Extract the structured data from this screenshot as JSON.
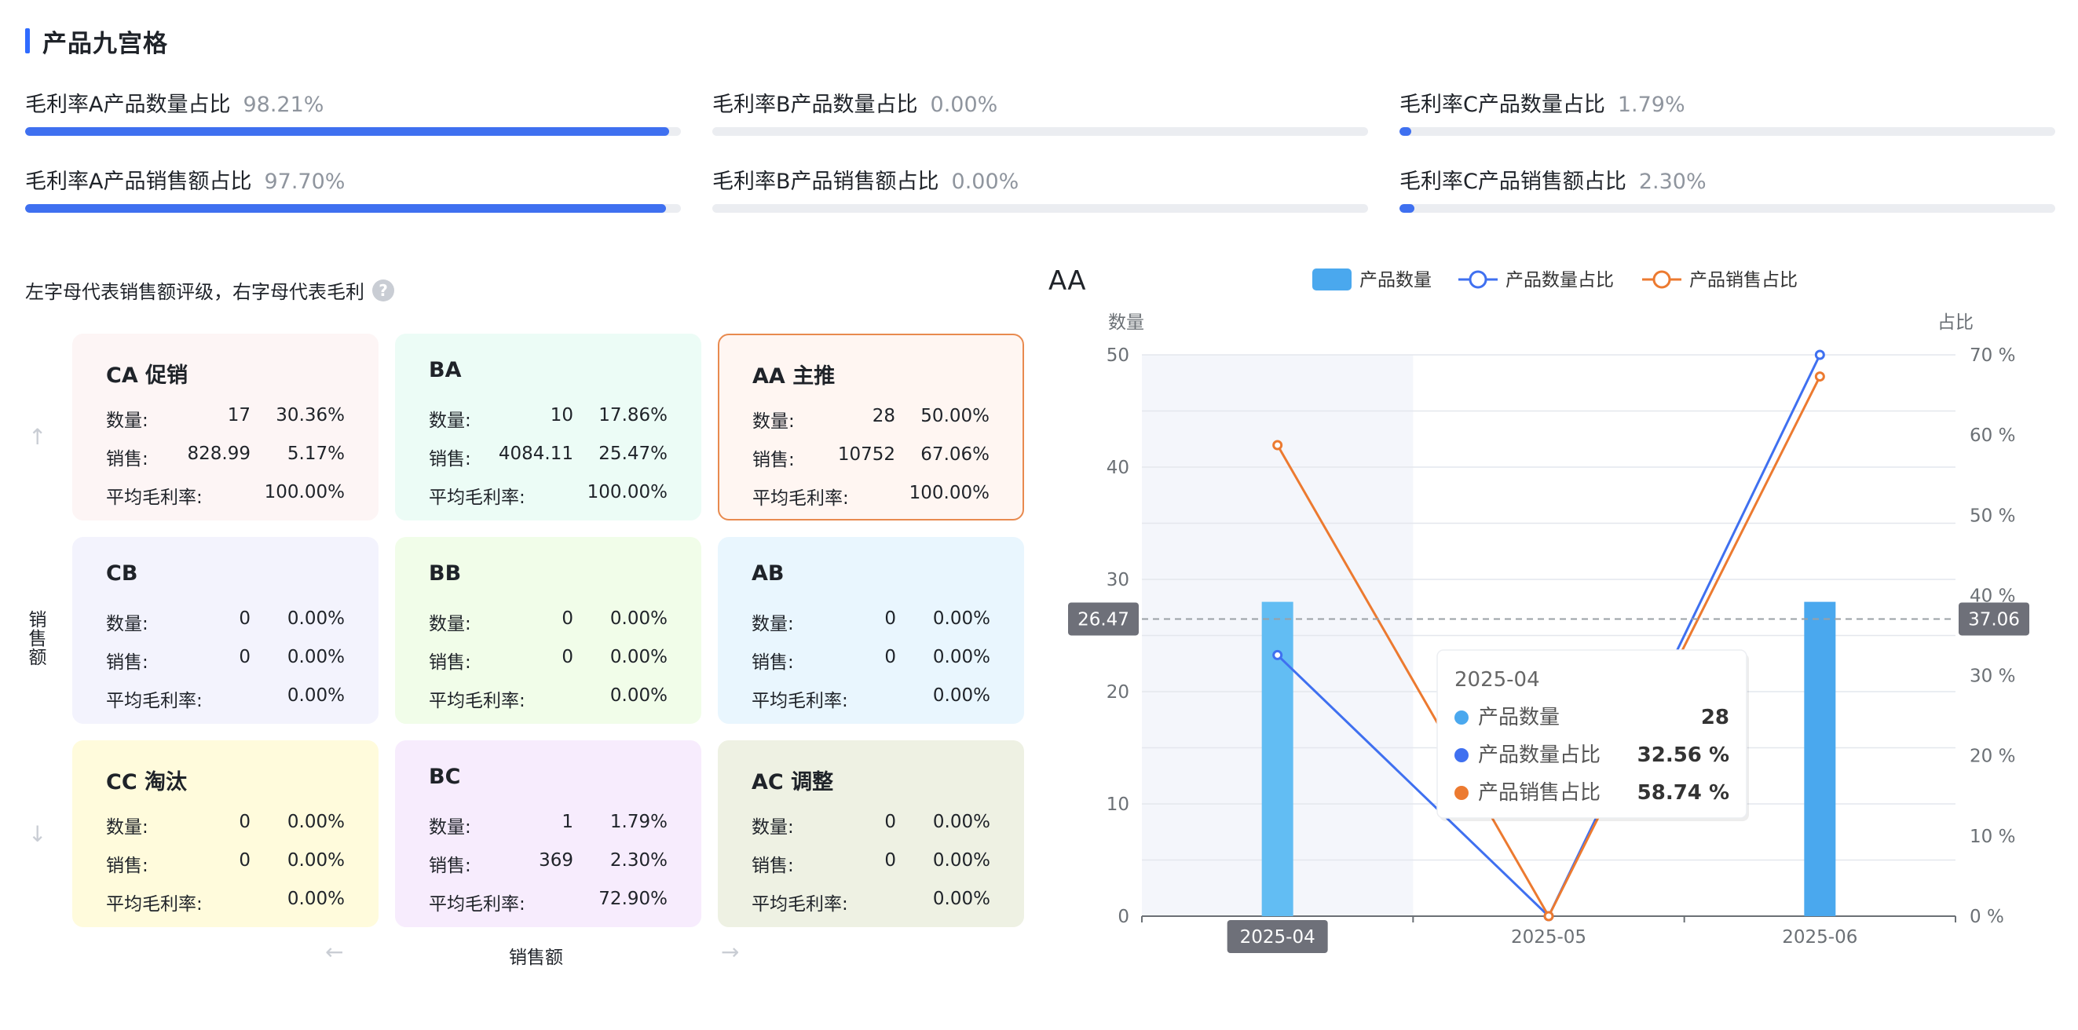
{
  "title": "产品九宫格",
  "ratios": [
    {
      "label": "毛利率A产品数量占比",
      "value": "98.21%",
      "fill": 0.9821
    },
    {
      "label": "毛利率B产品数量占比",
      "value": "0.00%",
      "fill": 0.0
    },
    {
      "label": "毛利率C产品数量占比",
      "value": "1.79%",
      "fill": 0.0179
    },
    {
      "label": "毛利率A产品销售额占比",
      "value": "97.70%",
      "fill": 0.977
    },
    {
      "label": "毛利率B产品销售额占比",
      "value": "0.00%",
      "fill": 0.0
    },
    {
      "label": "毛利率C产品销售额占比",
      "value": "2.30%",
      "fill": 0.023
    }
  ],
  "grid": {
    "note": "左字母代表销售额评级，右字母代表毛利",
    "help_glyph": "?",
    "y_label": "销售额",
    "x_label": "销售额",
    "up_arrow": "↑",
    "down_arrow": "↓",
    "left_arrow": "←",
    "right_arrow": "→",
    "qty_label": "数量:",
    "sales_label": "销售:",
    "margin_label": "平均毛利率:",
    "cells": [
      {
        "title": "CA 促销",
        "qty": "17",
        "qty_pct": "30.36%",
        "sales": "828.99",
        "sales_pct": "5.17%",
        "margin": "100.00%",
        "bg": "#fdf5f5",
        "border": "#fdf5f5"
      },
      {
        "title": "BA",
        "qty": "10",
        "qty_pct": "17.86%",
        "sales": "4084.11",
        "sales_pct": "25.47%",
        "margin": "100.00%",
        "bg": "#ecfcf6",
        "border": "#ecfcf6"
      },
      {
        "title": "AA 主推",
        "qty": "28",
        "qty_pct": "50.00%",
        "sales": "10752",
        "sales_pct": "67.06%",
        "margin": "100.00%",
        "bg": "#fff6f2",
        "border": "#e88a4f"
      },
      {
        "title": "CB",
        "qty": "0",
        "qty_pct": "0.00%",
        "sales": "0",
        "sales_pct": "0.00%",
        "margin": "0.00%",
        "bg": "#f3f3fd",
        "border": "#f3f3fd"
      },
      {
        "title": "BB",
        "qty": "0",
        "qty_pct": "0.00%",
        "sales": "0",
        "sales_pct": "0.00%",
        "margin": "0.00%",
        "bg": "#f1fde9",
        "border": "#f1fde9"
      },
      {
        "title": "AB",
        "qty": "0",
        "qty_pct": "0.00%",
        "sales": "0",
        "sales_pct": "0.00%",
        "margin": "0.00%",
        "bg": "#e9f6fe",
        "border": "#e9f6fe"
      },
      {
        "title": "CC 淘汰",
        "qty": "0",
        "qty_pct": "0.00%",
        "sales": "0",
        "sales_pct": "0.00%",
        "margin": "0.00%",
        "bg": "#fffbdc",
        "border": "#fffbdc"
      },
      {
        "title": "BC",
        "qty": "1",
        "qty_pct": "1.79%",
        "sales": "369",
        "sales_pct": "2.30%",
        "margin": "72.90%",
        "bg": "#f7ecfd",
        "border": "#f7ecfd"
      },
      {
        "title": "AC 调整",
        "qty": "0",
        "qty_pct": "0.00%",
        "sales": "0",
        "sales_pct": "0.00%",
        "margin": "0.00%",
        "bg": "#eef1e3",
        "border": "#eef1e3"
      }
    ]
  },
  "chart_data": {
    "type": "bar+line",
    "title": "AA",
    "categories": [
      "2025-04",
      "2025-05",
      "2025-06"
    ],
    "y_left": {
      "label": "数量",
      "range": [
        0,
        50
      ],
      "ticks": [
        0,
        10,
        20,
        30,
        40,
        50
      ]
    },
    "y_right": {
      "label": "占比",
      "range": [
        0,
        70
      ],
      "ticks": [
        "0 %",
        "10 %",
        "20 %",
        "30 %",
        "40 %",
        "50 %",
        "60 %",
        "70 %"
      ]
    },
    "series": [
      {
        "name": "产品数量",
        "type": "bar",
        "axis": "left",
        "values": [
          28,
          0,
          28
        ],
        "color": "#4aa8ee"
      },
      {
        "name": "产品数量占比",
        "type": "line",
        "axis": "right",
        "values": [
          32.56,
          0,
          70
        ],
        "color": "#3f70f0"
      },
      {
        "name": "产品销售占比",
        "type": "line",
        "axis": "right",
        "values": [
          58.74,
          0,
          67.3
        ],
        "color": "#ec7a30"
      }
    ],
    "reference_line": {
      "left_value": "26.47",
      "right_value": "37.06"
    },
    "highlight_category": "2025-04",
    "legend_position": "top",
    "tooltip": {
      "title": "2025-04",
      "rows": [
        {
          "name": "产品数量",
          "value": "28",
          "color": "#4aa8ee"
        },
        {
          "name": "产品数量占比",
          "value": "32.56 %",
          "color": "#3f70f0"
        },
        {
          "name": "产品销售占比",
          "value": "58.74 %",
          "color": "#ec7a30"
        }
      ]
    }
  }
}
